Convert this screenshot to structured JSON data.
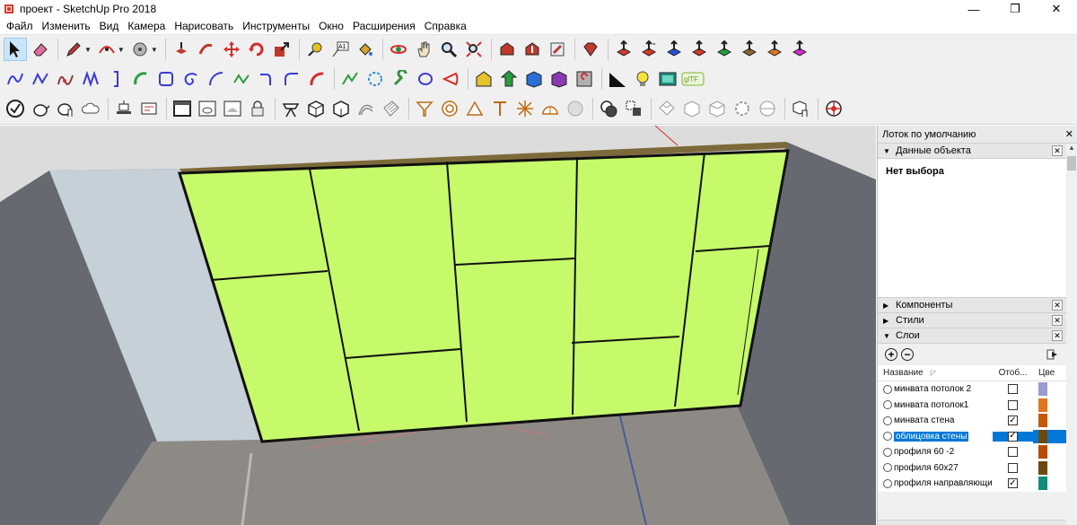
{
  "window": {
    "title": "проект - SketchUp Pro 2018",
    "minimize": "—",
    "restore": "❐",
    "close": "✕"
  },
  "menu": [
    "Файл",
    "Изменить",
    "Вид",
    "Камера",
    "Нарисовать",
    "Инструменты",
    "Окно",
    "Расширения",
    "Справка"
  ],
  "colors": {
    "panel_green": "#c6fa6a",
    "wall_gray": "#666a70",
    "floor": "#8d8a85",
    "selection": "#0078d7"
  },
  "tray": {
    "title": "Лоток по умолчанию",
    "close": "✕",
    "entity_info": {
      "title": "Данные объекта",
      "no_selection": "Нет выбора"
    },
    "components": {
      "title": "Компоненты"
    },
    "styles": {
      "title": "Стили"
    },
    "layers": {
      "title": "Слои",
      "add": "+",
      "remove": "−",
      "col_name": "Название",
      "col_visible": "Отоб...",
      "col_color": "Цве",
      "rows": [
        {
          "name": "минвата потолок 2",
          "visible": false,
          "color": "#9b9bd0",
          "selected": false
        },
        {
          "name": "минвата потолок1",
          "visible": false,
          "color": "#e0761d",
          "selected": false
        },
        {
          "name": "минвата стена",
          "visible": true,
          "color": "#c2590a",
          "selected": false
        },
        {
          "name": "облицовка стены",
          "visible": true,
          "color": "#6b4a12",
          "selected": true
        },
        {
          "name": "профиля 60 -2",
          "visible": false,
          "color": "#b84b05",
          "selected": false
        },
        {
          "name": "профиля 60х27",
          "visible": false,
          "color": "#6b4a12",
          "selected": false
        },
        {
          "name": "профиля направляющие",
          "visible": true,
          "color": "#138c7c",
          "selected": false
        }
      ]
    }
  }
}
